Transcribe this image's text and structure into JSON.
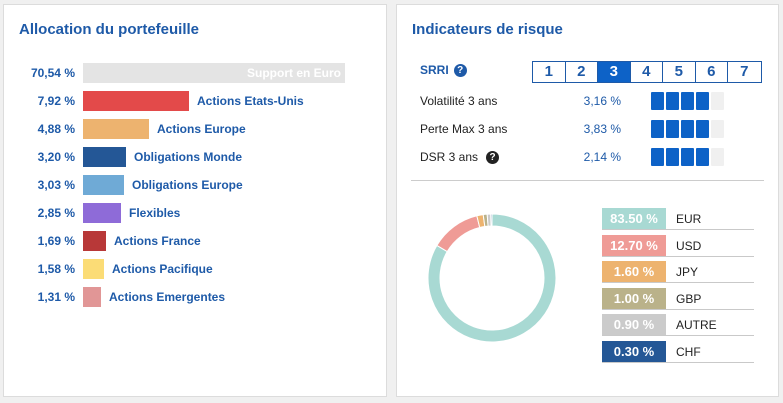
{
  "allocation": {
    "title": "Allocation du portefeuille",
    "items": [
      {
        "pct": "70,54 %",
        "value": 70.54,
        "label": "Support en Euro",
        "color": "#e4e4e4"
      },
      {
        "pct": "7,92 %",
        "value": 7.92,
        "label": "Actions Etats-Unis",
        "color": "#e34a4a"
      },
      {
        "pct": "4,88 %",
        "value": 4.88,
        "label": "Actions Europe",
        "color": "#edb36f"
      },
      {
        "pct": "3,20 %",
        "value": 3.2,
        "label": "Obligations Monde",
        "color": "#245796"
      },
      {
        "pct": "3,03 %",
        "value": 3.03,
        "label": "Obligations Europe",
        "color": "#6faad6"
      },
      {
        "pct": "2,85 %",
        "value": 2.85,
        "label": "Flexibles",
        "color": "#8e6bd8"
      },
      {
        "pct": "1,69 %",
        "value": 1.69,
        "label": "Actions France",
        "color": "#b83838"
      },
      {
        "pct": "1,58 %",
        "value": 1.58,
        "label": "Actions Pacifique",
        "color": "#fbdc76"
      },
      {
        "pct": "1,31 %",
        "value": 1.31,
        "label": "Actions Emergentes",
        "color": "#e19696"
      }
    ]
  },
  "risk": {
    "title": "Indicateurs de risque",
    "srri_label": "SRRI",
    "srri_scale": [
      "1",
      "2",
      "3",
      "4",
      "5",
      "6",
      "7"
    ],
    "srri_active": 3,
    "help_glyph": "?",
    "rows": [
      {
        "name": "Volatilité 3 ans",
        "value": "3,16 %",
        "level": 4,
        "help": false
      },
      {
        "name": "Perte Max 3 ans",
        "value": "3,83 %",
        "level": 4,
        "help": false
      },
      {
        "name": "DSR 3 ans",
        "value": "2,14 %",
        "level": 4,
        "help": true
      }
    ]
  },
  "currency": {
    "items": [
      {
        "pct": "83.50 %",
        "value": 83.5,
        "code": "EUR",
        "color": "#a8d9d3"
      },
      {
        "pct": "12.70 %",
        "value": 12.7,
        "code": "USD",
        "color": "#ef9b96"
      },
      {
        "pct": "1.60 %",
        "value": 1.6,
        "code": "JPY",
        "color": "#edb36f"
      },
      {
        "pct": "1.00 %",
        "value": 1.0,
        "code": "GBP",
        "color": "#bab28a"
      },
      {
        "pct": "0.90 %",
        "value": 0.9,
        "code": "AUTRE",
        "color": "#cbcbcb"
      },
      {
        "pct": "0.30 %",
        "value": 0.3,
        "code": "CHF",
        "color": "#245796"
      }
    ]
  }
}
